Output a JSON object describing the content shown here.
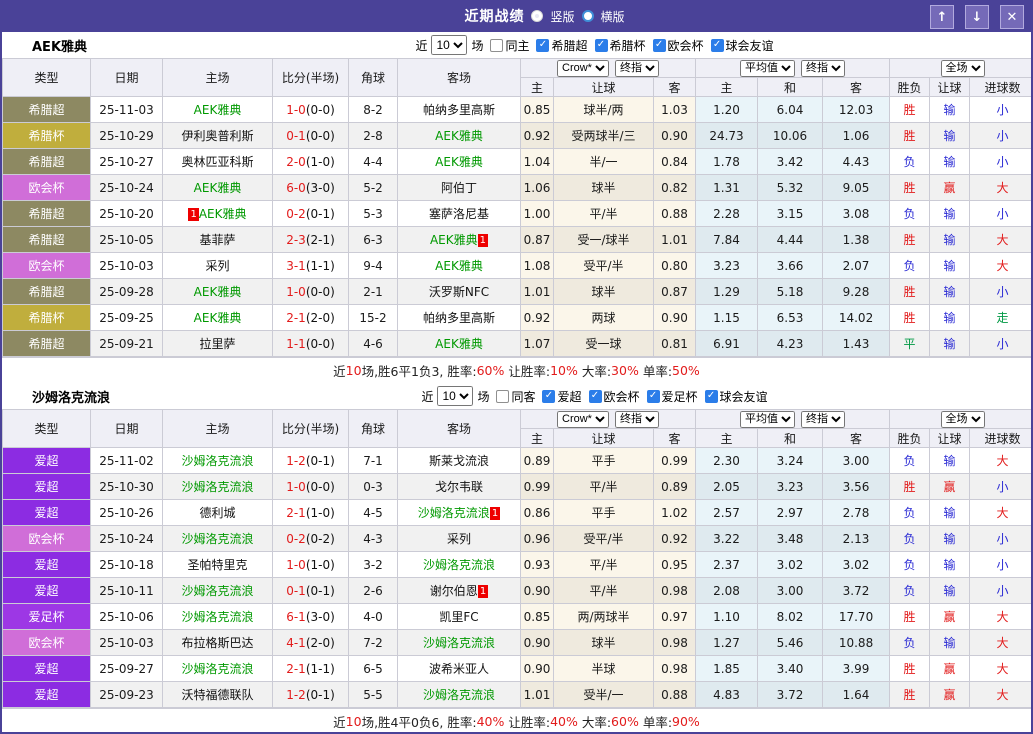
{
  "topbar": {
    "title": "近期战绩",
    "layout_options": [
      {
        "label": "竖版",
        "selected": true
      },
      {
        "label": "横版",
        "selected": false
      }
    ],
    "buttons": {
      "up": "↑",
      "down": "↓",
      "close": "✕"
    }
  },
  "table": {
    "headers": [
      "类型",
      "日期",
      "主场",
      "比分(半场)",
      "角球",
      "客场"
    ],
    "odds_groups": [
      {
        "selects": [
          "Crow*",
          "终指"
        ],
        "cols": [
          "主",
          "让球",
          "客"
        ]
      },
      {
        "selects": [
          "平均值",
          "终指"
        ],
        "cols": [
          "主",
          "和",
          "客"
        ]
      },
      {
        "selects": [
          "全场"
        ],
        "cols": [
          "胜负",
          "让球",
          "进球数"
        ]
      }
    ]
  },
  "league_colors": {
    "希腊超": "#8d8962",
    "希腊杯": "#c0ae3d",
    "欧会杯": "#d06ed8",
    "爱超": "#8c2ce2",
    "爱足杯": "#9d37e5"
  },
  "result_colors": {
    "胜": "#e21b1b",
    "负": "#2a2ad4",
    "平": "#009944",
    "赢": "#e21b1b",
    "输": "#2a2ad4",
    "走": "#009944",
    "大": "#e21b1b",
    "小": "#2a2ad4"
  },
  "teams": [
    {
      "name": "AEK雅典",
      "filters": {
        "near_label": "近",
        "count": "10",
        "games_label": "场",
        "same": {
          "label": "同主",
          "checked": false
        },
        "leagues": [
          {
            "label": "希腊超",
            "checked": true
          },
          {
            "label": "希腊杯",
            "checked": true
          },
          {
            "label": "欧会杯",
            "checked": true
          },
          {
            "label": "球会友谊",
            "checked": true
          }
        ]
      },
      "rows": [
        {
          "type": "希腊超",
          "date": "25-11-03",
          "home": "AEK雅典",
          "home_self": 1,
          "score": "1-0",
          "half": "(0-0)",
          "corner": "8-2",
          "away": "帕纳多里高斯",
          "h": [
            "0.85",
            "球半/两",
            "1.03"
          ],
          "e": [
            "1.20",
            "6.04",
            "12.03"
          ],
          "r": [
            "胜",
            "输",
            "小"
          ]
        },
        {
          "type": "希腊杯",
          "date": "25-10-29",
          "home": "伊利奥普利斯",
          "score": "0-1",
          "half": "(0-0)",
          "corner": "2-8",
          "away": "AEK雅典",
          "away_self": 1,
          "h": [
            "0.92",
            "受两球半/三",
            "0.90"
          ],
          "e": [
            "24.73",
            "10.06",
            "1.06"
          ],
          "r": [
            "胜",
            "输",
            "小"
          ]
        },
        {
          "type": "希腊超",
          "date": "25-10-27",
          "home": "奥林匹亚科斯",
          "score": "2-0",
          "half": "(1-0)",
          "corner": "4-4",
          "away": "AEK雅典",
          "away_self": 1,
          "h": [
            "1.04",
            "半/一",
            "0.84"
          ],
          "e": [
            "1.78",
            "3.42",
            "4.43"
          ],
          "r": [
            "负",
            "输",
            "小"
          ]
        },
        {
          "type": "欧会杯",
          "date": "25-10-24",
          "home": "AEK雅典",
          "home_self": 1,
          "score": "6-0",
          "half": "(3-0)",
          "corner": "5-2",
          "away": "阿伯丁",
          "h": [
            "1.06",
            "球半",
            "0.82"
          ],
          "e": [
            "1.31",
            "5.32",
            "9.05"
          ],
          "r": [
            "胜",
            "赢",
            "大"
          ]
        },
        {
          "type": "希腊超",
          "date": "25-10-20",
          "home": "AEK雅典",
          "home_self": 1,
          "home_badge_before": "1",
          "score": "0-2",
          "half": "(0-1)",
          "corner": "5-3",
          "away": "塞萨洛尼基",
          "h": [
            "1.00",
            "平/半",
            "0.88"
          ],
          "e": [
            "2.28",
            "3.15",
            "3.08"
          ],
          "r": [
            "负",
            "输",
            "小"
          ]
        },
        {
          "type": "希腊超",
          "date": "25-10-05",
          "home": "基菲萨",
          "score": "2-3",
          "half": "(2-1)",
          "corner": "6-3",
          "away": "AEK雅典",
          "away_self": 1,
          "away_badge_after": "1",
          "h": [
            "0.87",
            "受一/球半",
            "1.01"
          ],
          "e": [
            "7.84",
            "4.44",
            "1.38"
          ],
          "r": [
            "胜",
            "输",
            "大"
          ]
        },
        {
          "type": "欧会杯",
          "date": "25-10-03",
          "home": "采列",
          "score": "3-1",
          "half": "(1-1)",
          "corner": "9-4",
          "away": "AEK雅典",
          "away_self": 1,
          "h": [
            "1.08",
            "受平/半",
            "0.80"
          ],
          "e": [
            "3.23",
            "3.66",
            "2.07"
          ],
          "r": [
            "负",
            "输",
            "大"
          ]
        },
        {
          "type": "希腊超",
          "date": "25-09-28",
          "home": "AEK雅典",
          "home_self": 1,
          "score": "1-0",
          "half": "(0-0)",
          "corner": "2-1",
          "away": "沃罗斯NFC",
          "h": [
            "1.01",
            "球半",
            "0.87"
          ],
          "e": [
            "1.29",
            "5.18",
            "9.28"
          ],
          "r": [
            "胜",
            "输",
            "小"
          ]
        },
        {
          "type": "希腊杯",
          "date": "25-09-25",
          "home": "AEK雅典",
          "home_self": 1,
          "score": "2-1",
          "half": "(2-0)",
          "corner": "15-2",
          "away": "帕纳多里高斯",
          "h": [
            "0.92",
            "两球",
            "0.90"
          ],
          "e": [
            "1.15",
            "6.53",
            "14.02"
          ],
          "r": [
            "胜",
            "输",
            "走"
          ]
        },
        {
          "type": "希腊超",
          "date": "25-09-21",
          "home": "拉里萨",
          "score": "1-1",
          "half": "(0-0)",
          "corner": "4-6",
          "away": "AEK雅典",
          "away_self": 1,
          "h": [
            "1.07",
            "受一球",
            "0.81"
          ],
          "e": [
            "6.91",
            "4.23",
            "1.43"
          ],
          "r": [
            "平",
            "输",
            "小"
          ]
        }
      ],
      "summary": [
        {
          "text": "近"
        },
        {
          "text": "10",
          "red": true
        },
        {
          "text": "场,胜6平1负3, 胜率:"
        },
        {
          "text": "60%",
          "red": true
        },
        {
          "text": " 让胜率:"
        },
        {
          "text": "10%",
          "red": true
        },
        {
          "text": " 大率:"
        },
        {
          "text": "30%",
          "red": true
        },
        {
          "text": " 单率:"
        },
        {
          "text": "50%",
          "red": true
        }
      ]
    },
    {
      "name": "沙姆洛克流浪",
      "filters": {
        "near_label": "近",
        "count": "10",
        "games_label": "场",
        "same": {
          "label": "同客",
          "checked": false
        },
        "leagues": [
          {
            "label": "爱超",
            "checked": true
          },
          {
            "label": "欧会杯",
            "checked": true
          },
          {
            "label": "爱足杯",
            "checked": true
          },
          {
            "label": "球会友谊",
            "checked": true
          }
        ]
      },
      "rows": [
        {
          "type": "爱超",
          "date": "25-11-02",
          "home": "沙姆洛克流浪",
          "home_self": 1,
          "score": "1-2",
          "half": "(0-1)",
          "corner": "7-1",
          "away": "斯莱戈流浪",
          "h": [
            "0.89",
            "平手",
            "0.99"
          ],
          "e": [
            "2.30",
            "3.24",
            "3.00"
          ],
          "r": [
            "负",
            "输",
            "大"
          ]
        },
        {
          "type": "爱超",
          "date": "25-10-30",
          "home": "沙姆洛克流浪",
          "home_self": 1,
          "score": "1-0",
          "half": "(0-0)",
          "corner": "0-3",
          "away": "戈尔韦联",
          "h": [
            "0.99",
            "平/半",
            "0.89"
          ],
          "e": [
            "2.05",
            "3.23",
            "3.56"
          ],
          "r": [
            "胜",
            "赢",
            "小"
          ]
        },
        {
          "type": "爱超",
          "date": "25-10-26",
          "home": "德利城",
          "score": "2-1",
          "half": "(1-0)",
          "corner": "4-5",
          "away": "沙姆洛克流浪",
          "away_self": 1,
          "away_badge_after": "1",
          "h": [
            "0.86",
            "平手",
            "1.02"
          ],
          "e": [
            "2.57",
            "2.97",
            "2.78"
          ],
          "r": [
            "负",
            "输",
            "大"
          ]
        },
        {
          "type": "欧会杯",
          "date": "25-10-24",
          "home": "沙姆洛克流浪",
          "home_self": 1,
          "score": "0-2",
          "half": "(0-2)",
          "corner": "4-3",
          "away": "采列",
          "h": [
            "0.96",
            "受平/半",
            "0.92"
          ],
          "e": [
            "3.22",
            "3.48",
            "2.13"
          ],
          "r": [
            "负",
            "输",
            "小"
          ]
        },
        {
          "type": "爱超",
          "date": "25-10-18",
          "home": "圣帕特里克",
          "score": "1-0",
          "half": "(1-0)",
          "corner": "3-2",
          "away": "沙姆洛克流浪",
          "away_self": 1,
          "h": [
            "0.93",
            "平/半",
            "0.95"
          ],
          "e": [
            "2.37",
            "3.02",
            "3.02"
          ],
          "r": [
            "负",
            "输",
            "小"
          ]
        },
        {
          "type": "爱超",
          "date": "25-10-11",
          "home": "沙姆洛克流浪",
          "home_self": 1,
          "score": "0-1",
          "half": "(0-1)",
          "corner": "2-6",
          "away": "谢尔伯恩",
          "away_badge_after": "1",
          "h": [
            "0.90",
            "平/半",
            "0.98"
          ],
          "e": [
            "2.08",
            "3.00",
            "3.72"
          ],
          "r": [
            "负",
            "输",
            "小"
          ]
        },
        {
          "type": "爱足杯",
          "date": "25-10-06",
          "home": "沙姆洛克流浪",
          "home_self": 1,
          "score": "6-1",
          "half": "(3-0)",
          "corner": "4-0",
          "away": "凯里FC",
          "h": [
            "0.85",
            "两/两球半",
            "0.97"
          ],
          "e": [
            "1.10",
            "8.02",
            "17.70"
          ],
          "r": [
            "胜",
            "赢",
            "大"
          ]
        },
        {
          "type": "欧会杯",
          "date": "25-10-03",
          "home": "布拉格斯巴达",
          "score": "4-1",
          "half": "(2-0)",
          "corner": "7-2",
          "away": "沙姆洛克流浪",
          "away_self": 1,
          "h": [
            "0.90",
            "球半",
            "0.98"
          ],
          "e": [
            "1.27",
            "5.46",
            "10.88"
          ],
          "r": [
            "负",
            "输",
            "大"
          ]
        },
        {
          "type": "爱超",
          "date": "25-09-27",
          "home": "沙姆洛克流浪",
          "home_self": 1,
          "score": "2-1",
          "half": "(1-1)",
          "corner": "6-5",
          "away": "波希米亚人",
          "h": [
            "0.90",
            "半球",
            "0.98"
          ],
          "e": [
            "1.85",
            "3.40",
            "3.99"
          ],
          "r": [
            "胜",
            "赢",
            "大"
          ]
        },
        {
          "type": "爱超",
          "date": "25-09-23",
          "home": "沃特福德联队",
          "score": "1-2",
          "half": "(0-1)",
          "corner": "5-5",
          "away": "沙姆洛克流浪",
          "away_self": 1,
          "h": [
            "1.01",
            "受半/一",
            "0.88"
          ],
          "e": [
            "4.83",
            "3.72",
            "1.64"
          ],
          "r": [
            "胜",
            "赢",
            "大"
          ]
        }
      ],
      "summary": [
        {
          "text": "近"
        },
        {
          "text": "10",
          "red": true
        },
        {
          "text": "场,胜4平0负6, 胜率:"
        },
        {
          "text": "40%",
          "red": true
        },
        {
          "text": " 让胜率:"
        },
        {
          "text": "40%",
          "red": true
        },
        {
          "text": " 大率:"
        },
        {
          "text": "60%",
          "red": true
        },
        {
          "text": " 单率:"
        },
        {
          "text": "90%",
          "red": true
        }
      ]
    }
  ]
}
